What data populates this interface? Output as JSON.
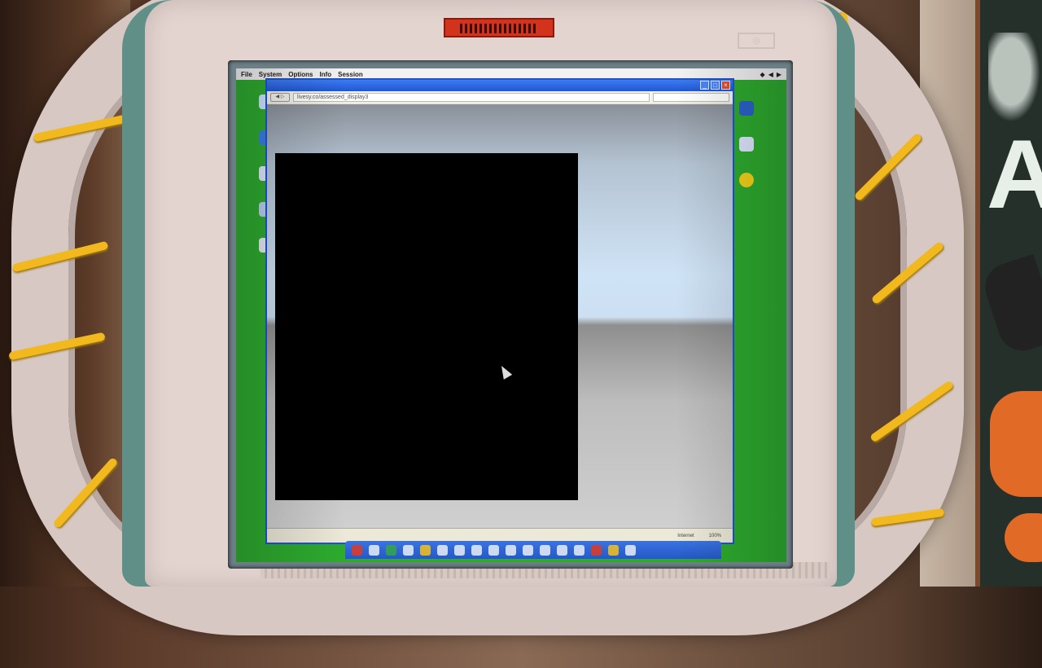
{
  "menubar": {
    "items": [
      "File",
      "System",
      "Options",
      "Info",
      "Session"
    ],
    "tray": [
      "◆",
      "◀",
      "▶"
    ]
  },
  "browser": {
    "window_buttons": [
      "_",
      "□",
      "×"
    ],
    "back_label": "◀ ▷",
    "url": "livesy.co/assessed_display3",
    "status_zone": "Internet",
    "zoom": "100%"
  },
  "desktop": {
    "left_icons": [
      "app-icon",
      "app-icon",
      "app-icon",
      "app-icon",
      "app-icon"
    ],
    "right_icons": [
      "app-icon",
      "app-icon",
      "star-icon"
    ]
  },
  "taskbar": {
    "icons": [
      "power-icon",
      "windows-icon",
      "globe-icon",
      "gear-icon",
      "folder-icon",
      "info-icon",
      "doc-icon",
      "app-icon",
      "app-icon",
      "app-icon",
      "app-icon",
      "app-icon",
      "app-icon",
      "app-icon",
      "app-icon",
      "app-icon",
      "star-icon",
      "app-icon"
    ]
  },
  "colors": {
    "desktop_green": "#2eab2f",
    "titlebar_blue": "#1f57d6",
    "kiosk_red_badge": "#d2331c",
    "bezel_teal": "#5f8f86",
    "wire_yellow": "#f2b91f"
  }
}
